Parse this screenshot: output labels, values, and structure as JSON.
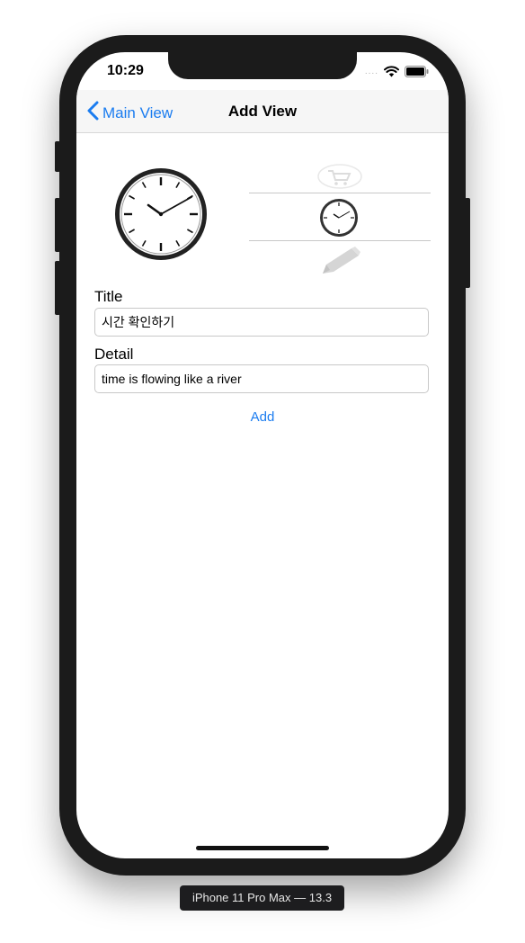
{
  "status_bar": {
    "time": "10:29",
    "signal_dots": "....",
    "icons": [
      "wifi-icon",
      "battery-icon"
    ]
  },
  "navbar": {
    "back_label": "Main View",
    "title": "Add View"
  },
  "image_preview": {
    "icon": "clock-icon"
  },
  "image_picker": {
    "items": [
      {
        "icon": "cart-icon",
        "selected": false
      },
      {
        "icon": "clock-icon",
        "selected": true
      },
      {
        "icon": "pencil-icon",
        "selected": false
      }
    ]
  },
  "form": {
    "title_label": "Title",
    "title_value": "시간 확인하기",
    "detail_label": "Detail",
    "detail_value": "time is flowing like a river",
    "add_label": "Add"
  },
  "simulator": {
    "device_label": "iPhone 11 Pro Max — 13.3"
  },
  "colors": {
    "accent": "#1a7cf0",
    "frame": "#1b1b1b",
    "navbar_bg": "#f6f6f6"
  }
}
